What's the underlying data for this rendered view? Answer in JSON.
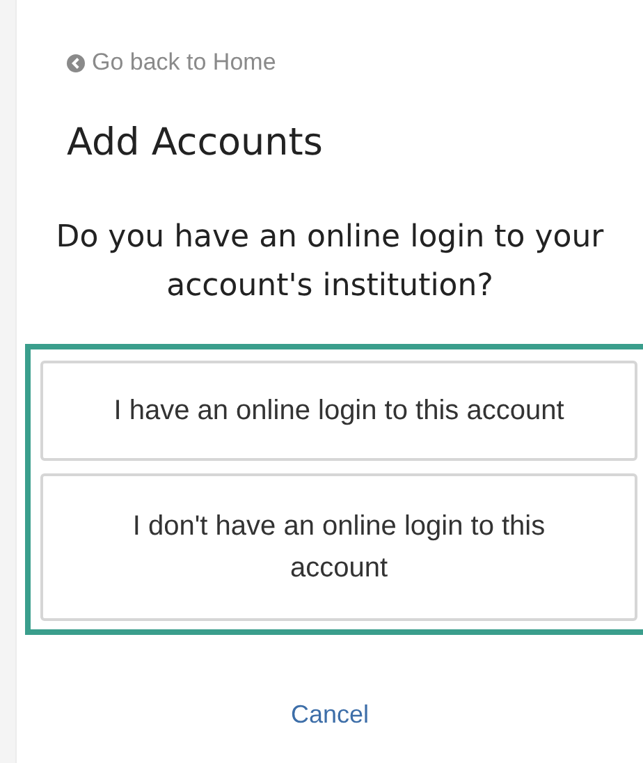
{
  "back_link": {
    "label": "Go back to Home"
  },
  "title": "Add Accounts",
  "question": "Do you have an online login to your account's institution?",
  "options": [
    {
      "label": "I have an online login to this account"
    },
    {
      "label": "I don't have an online login to this account"
    }
  ],
  "cancel": "Cancel"
}
